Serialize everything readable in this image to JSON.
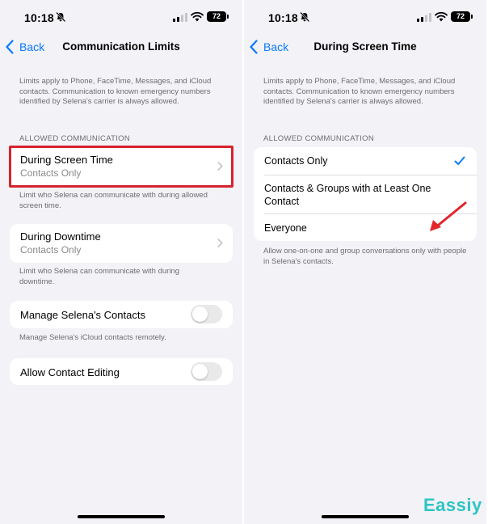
{
  "status_bar": {
    "time": "10:18",
    "battery": "72"
  },
  "left": {
    "back_label": "Back",
    "title": "Communication Limits",
    "intro": "Limits apply to Phone, FaceTime, Messages, and iCloud contacts. Communication to known emergency numbers identified by Selena's carrier is always allowed.",
    "section_header": "ALLOWED COMMUNICATION",
    "screen_time_row": {
      "title": "During Screen Time",
      "value": "Contacts Only"
    },
    "screen_time_note": "Limit who Selena can communicate with during allowed screen time.",
    "downtime_row": {
      "title": "During Downtime",
      "value": "Contacts Only"
    },
    "downtime_note": "Limit who Selena can communicate with during downtime.",
    "manage_contacts": {
      "label": "Manage Selena's Contacts",
      "on": false
    },
    "manage_note": "Manage Selena's iCloud contacts remotely.",
    "allow_editing": {
      "label": "Allow Contact Editing",
      "on": false
    }
  },
  "right": {
    "back_label": "Back",
    "title": "During Screen Time",
    "intro": "Limits apply to Phone, FaceTime, Messages, and iCloud contacts. Communication to known emergency numbers identified by Selena's carrier is always allowed.",
    "section_header": "ALLOWED COMMUNICATION",
    "options": [
      {
        "label": "Contacts Only",
        "selected": true
      },
      {
        "label": "Contacts & Groups with at Least One Contact",
        "selected": false
      },
      {
        "label": "Everyone",
        "selected": false
      }
    ],
    "footer_note": "Allow one-on-one and group conversations only with people in Selena's contacts."
  },
  "brand": "Eassiy",
  "colors": {
    "accent": "#0a7aff",
    "highlight": "#d7232e",
    "arrow": "#e3262e",
    "brand": "#2ec4c4",
    "background": "#f2f2f7"
  }
}
